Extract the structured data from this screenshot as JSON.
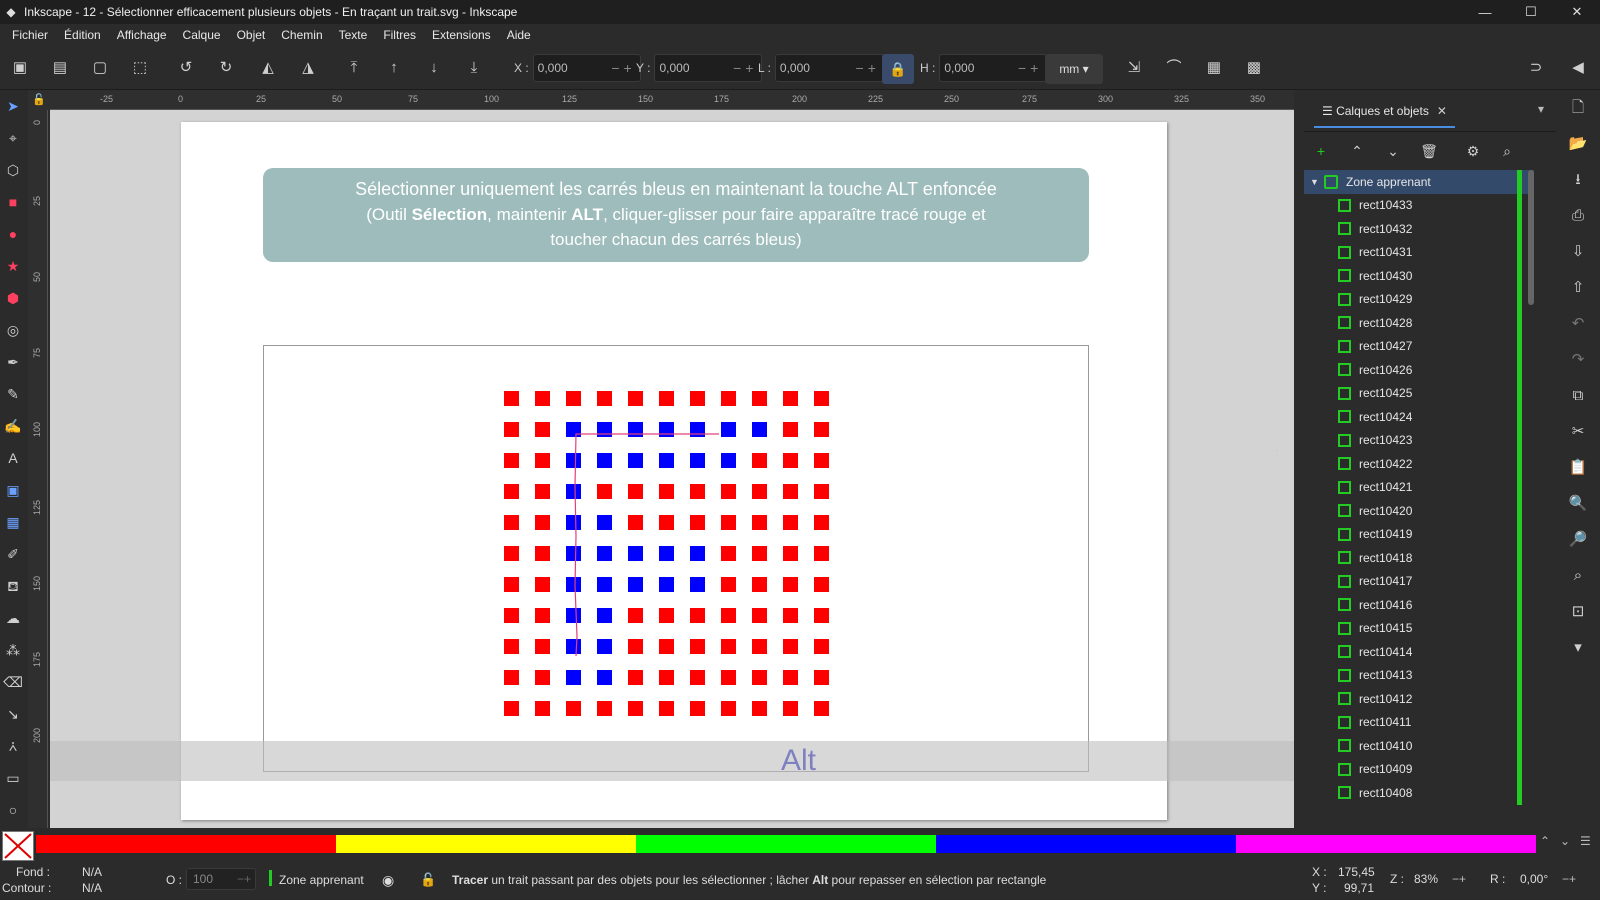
{
  "window": {
    "title": "Inkscape - 12 - Sélectionner efficacement plusieurs objets - En traçant un trait.svg - Inkscape",
    "controls": [
      "—",
      "☐",
      "✕"
    ]
  },
  "menu": [
    "Fichier",
    "Édition",
    "Affichage",
    "Calque",
    "Objet",
    "Chemin",
    "Texte",
    "Filtres",
    "Extensions",
    "Aide"
  ],
  "toolbar": {
    "x_label": "X :",
    "x_value": "0,000",
    "y_label": "Y :",
    "y_value": "0,000",
    "w_label": "L :",
    "w_value": "0,000",
    "h_label": "H :",
    "h_value": "0,000",
    "unit": "mm"
  },
  "ruler": {
    "top_ticks": [
      "-25",
      "0",
      "25",
      "50",
      "75",
      "100",
      "125",
      "150",
      "175",
      "200",
      "225",
      "250",
      "275",
      "300",
      "325",
      "350"
    ],
    "left_ticks": [
      "0",
      "25",
      "50",
      "75",
      "100",
      "125",
      "150",
      "175",
      "200"
    ]
  },
  "canvas": {
    "banner_line1": "Sélectionner uniquement les carrés bleus en maintenant la touche ALT enfoncée",
    "banner_line2_a": "(Outil ",
    "banner_line2_b": "Sélection",
    "banner_line2_c": ", maintenir ",
    "banner_line2_d": "ALT",
    "banner_line2_e": ", cliquer-glisser pour faire apparaître tracé rouge et",
    "banner_line3": "toucher chacun des carrés bleus)",
    "alt_label": "Alt",
    "grid_rows": [
      "RRRRRRRRRRR",
      "RRBBBBBBBRR",
      "RRBBBBBBRRR",
      "RRBRRRRRRRR",
      "RRBBRRRRRRR",
      "RRBBBBBRRRR",
      "RRBBBBBRRRR",
      "RRBBRRRRRRR",
      "RRBBRRRRRRR",
      "RRBBRRRRRRR",
      "RRRRRRRRRRR"
    ],
    "colors": {
      "red": "#ff0000",
      "blue": "#0000ff",
      "banner": "#9dbcbb",
      "trace": "#e0407a"
    }
  },
  "panel": {
    "tab_label": "Calques et objets",
    "layer_name": "Zone apprenant",
    "objects": [
      "rect10433",
      "rect10432",
      "rect10431",
      "rect10430",
      "rect10429",
      "rect10428",
      "rect10427",
      "rect10426",
      "rect10425",
      "rect10424",
      "rect10423",
      "rect10422",
      "rect10421",
      "rect10420",
      "rect10419",
      "rect10418",
      "rect10417",
      "rect10416",
      "rect10415",
      "rect10414",
      "rect10413",
      "rect10412",
      "rect10411",
      "rect10410",
      "rect10409",
      "rect10408"
    ]
  },
  "palette": {
    "swatches": [
      "#ff0000",
      "#ffff00",
      "#00ff00",
      "#0000ff",
      "#ff00ff"
    ]
  },
  "status": {
    "fill_label": "Fond :",
    "fill_value": "N/A",
    "stroke_label": "Contour :",
    "stroke_value": "N/A",
    "opacity_label": "O :",
    "opacity_value": "100",
    "layer": "Zone apprenant",
    "message_a": "Tracer",
    "message_b": " un trait passant par des objets pour les sélectionner ; lâcher ",
    "message_c": "Alt",
    "message_d": " pour repasser en sélection par rectangle",
    "x_label": "X :",
    "x_value": "175,45",
    "y_label": "Y :",
    "y_value": "99,71",
    "zoom_label": "Z :",
    "zoom_value": "83%",
    "rotation_label": "R :",
    "rotation_value": "0,00°"
  }
}
